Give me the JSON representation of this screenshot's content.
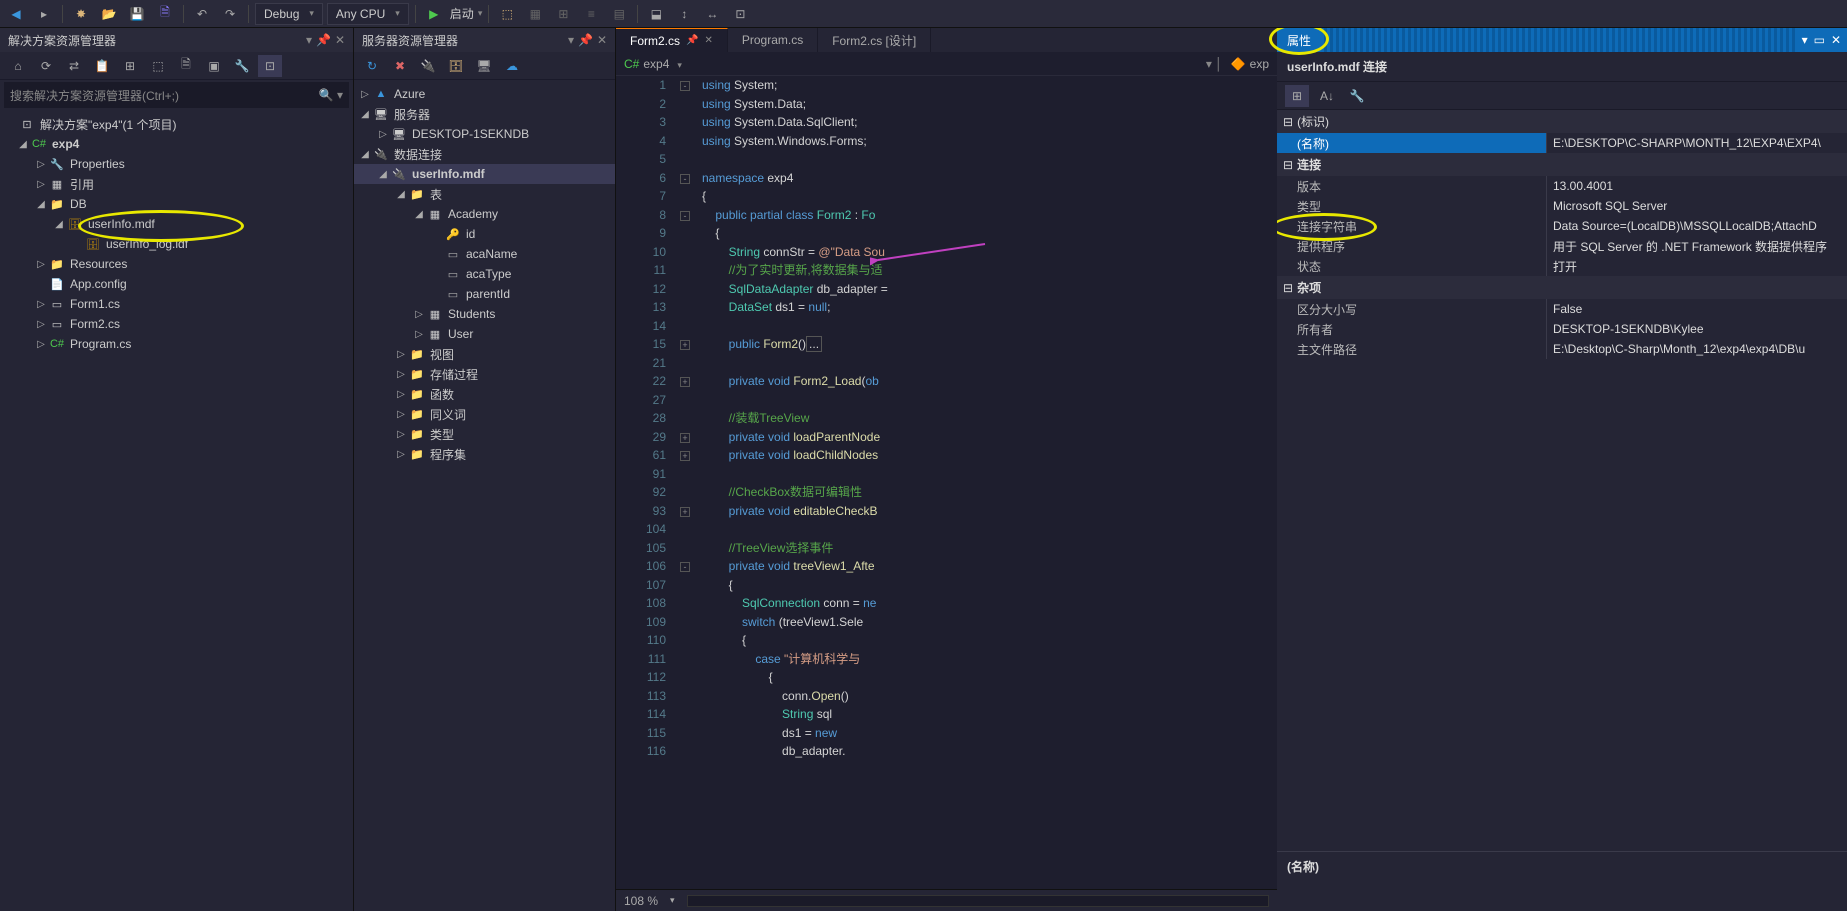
{
  "toolbar": {
    "config": "Debug",
    "platform": "Any CPU",
    "start": "启动"
  },
  "solutionExplorer": {
    "title": "解决方案资源管理器",
    "searchPlaceholder": "搜索解决方案资源管理器(Ctrl+;)",
    "root": "解决方案\"exp4\"(1 个项目)",
    "project": "exp4",
    "nodes": {
      "properties": "Properties",
      "references": "引用",
      "db": "DB",
      "userInfo": "userInfo.mdf",
      "userInfoLog": "userInfo_log.ldf",
      "resources": "Resources",
      "appConfig": "App.config",
      "form1": "Form1.cs",
      "form2": "Form2.cs",
      "program": "Program.cs"
    }
  },
  "serverExplorer": {
    "title": "服务器资源管理器",
    "nodes": {
      "azure": "Azure",
      "servers": "服务器",
      "desktop": "DESKTOP-1SEKNDB",
      "dataConn": "数据连接",
      "userInfo": "userInfo.mdf",
      "tables": "表",
      "academy": "Academy",
      "id": "id",
      "acaName": "acaName",
      "acaType": "acaType",
      "parentId": "parentId",
      "students": "Students",
      "user": "User",
      "views": "视图",
      "procs": "存储过程",
      "funcs": "函数",
      "synonyms": "同义词",
      "types": "类型",
      "assemblies": "程序集"
    }
  },
  "editor": {
    "tabs": {
      "form2": "Form2.cs",
      "program": "Program.cs",
      "form2design": "Form2.cs [设计]"
    },
    "breadcrumb": {
      "proj": "exp4",
      "ns": "exp"
    },
    "zoom": "108 %",
    "lines": [
      {
        "n": 1,
        "f": "-",
        "html": "<span class='k'>using</span> System;"
      },
      {
        "n": 2,
        "f": "",
        "html": "<span class='k'>using</span> System.Data;"
      },
      {
        "n": 3,
        "f": "",
        "html": "<span class='k'>using</span> System.Data.SqlClient;"
      },
      {
        "n": 4,
        "f": "",
        "html": "<span class='k'>using</span> System.Windows.Forms;"
      },
      {
        "n": 5,
        "f": "",
        "html": ""
      },
      {
        "n": 6,
        "f": "-",
        "html": "<span class='k'>namespace</span> exp4"
      },
      {
        "n": 7,
        "f": "",
        "html": "{"
      },
      {
        "n": 8,
        "f": "-",
        "html": "    <span class='k'>public partial class</span> <span class='t'>Form2</span> : <span class='t'>Fo</span>"
      },
      {
        "n": 9,
        "f": "",
        "html": "    {"
      },
      {
        "n": 10,
        "f": "",
        "html": "        <span class='t'>String</span> connStr = <span class='s'>@\"Data Sou</span>"
      },
      {
        "n": 11,
        "f": "",
        "html": "        <span class='c'>//为了实时更新,将数据集与适</span>"
      },
      {
        "n": 12,
        "f": "",
        "html": "        <span class='t'>SqlDataAdapter</span> db_adapter ="
      },
      {
        "n": 13,
        "f": "",
        "html": "        <span class='t'>DataSet</span> ds1 = <span class='k'>null</span>;"
      },
      {
        "n": 14,
        "f": "",
        "html": ""
      },
      {
        "n": 15,
        "f": "+",
        "html": "        <span class='k'>public</span> <span class='m'>Form2</span>()<span style='border:1px solid #555;padding:0 2px;'>...</span>"
      },
      {
        "n": 21,
        "f": "",
        "html": ""
      },
      {
        "n": 22,
        "f": "+",
        "html": "        <span class='k'>private void</span> <span class='m'>Form2_Load</span>(<span class='k'>ob</span>"
      },
      {
        "n": 27,
        "f": "",
        "html": ""
      },
      {
        "n": 28,
        "f": "",
        "html": "        <span class='c'>//装载TreeView</span>"
      },
      {
        "n": 29,
        "f": "+",
        "html": "        <span class='k'>private void</span> <span class='m'>loadParentNode</span>"
      },
      {
        "n": 61,
        "f": "+",
        "html": "        <span class='k'>private void</span> <span class='m'>loadChildNodes</span>"
      },
      {
        "n": 91,
        "f": "",
        "html": ""
      },
      {
        "n": 92,
        "f": "",
        "html": "        <span class='c'>//CheckBox数据可编辑性</span>"
      },
      {
        "n": 93,
        "f": "+",
        "html": "        <span class='k'>private void</span> <span class='m'>editableCheckB</span>"
      },
      {
        "n": 104,
        "f": "",
        "html": ""
      },
      {
        "n": 105,
        "f": "",
        "html": "        <span class='c'>//TreeView选择事件</span>"
      },
      {
        "n": 106,
        "f": "-",
        "html": "        <span class='k'>private void</span> <span class='m'>treeView1_Afte</span>"
      },
      {
        "n": 107,
        "f": "",
        "html": "        {"
      },
      {
        "n": 108,
        "f": "",
        "html": "            <span class='t'>SqlConnection</span> conn = <span class='k'>ne</span>"
      },
      {
        "n": 109,
        "f": "",
        "html": "            <span class='k'>switch</span> (treeView1.Sele"
      },
      {
        "n": 110,
        "f": "",
        "html": "            {"
      },
      {
        "n": 111,
        "f": "",
        "html": "                <span class='k'>case</span> <span class='s'>\"计算机科学与</span>"
      },
      {
        "n": 112,
        "f": "",
        "html": "                    {"
      },
      {
        "n": 113,
        "f": "",
        "html": "                        conn.<span class='m'>Open</span>()"
      },
      {
        "n": 114,
        "f": "",
        "html": "                        <span class='t'>String</span> sql"
      },
      {
        "n": 115,
        "f": "",
        "html": "                        ds1 = <span class='k'>new</span> "
      },
      {
        "n": 116,
        "f": "",
        "html": "                        db_adapter."
      }
    ]
  },
  "properties": {
    "tab": "属性",
    "header": "userInfo.mdf 连接",
    "cats": {
      "identity": "(标识)",
      "connection": "连接",
      "misc": "杂项"
    },
    "rows": {
      "name": {
        "label": "(名称)",
        "value": "E:\\DESKTOP\\C-SHARP\\MONTH_12\\EXP4\\EXP4\\"
      },
      "version": {
        "label": "版本",
        "value": "13.00.4001"
      },
      "type": {
        "label": "类型",
        "value": "Microsoft SQL Server"
      },
      "connStr": {
        "label": "连接字符串",
        "value": "Data Source=(LocalDB)\\MSSQLLocalDB;AttachD"
      },
      "provider": {
        "label": "提供程序",
        "value": "用于 SQL Server 的 .NET Framework 数据提供程序"
      },
      "state": {
        "label": "状态",
        "value": "打开"
      },
      "caseSens": {
        "label": "区分大小写",
        "value": "False"
      },
      "owner": {
        "label": "所有者",
        "value": "DESKTOP-1SEKNDB\\Kylee"
      },
      "mainPath": {
        "label": "主文件路径",
        "value": "E:\\Desktop\\C-Sharp\\Month_12\\exp4\\exp4\\DB\\u"
      }
    },
    "descLabel": "(名称)"
  }
}
